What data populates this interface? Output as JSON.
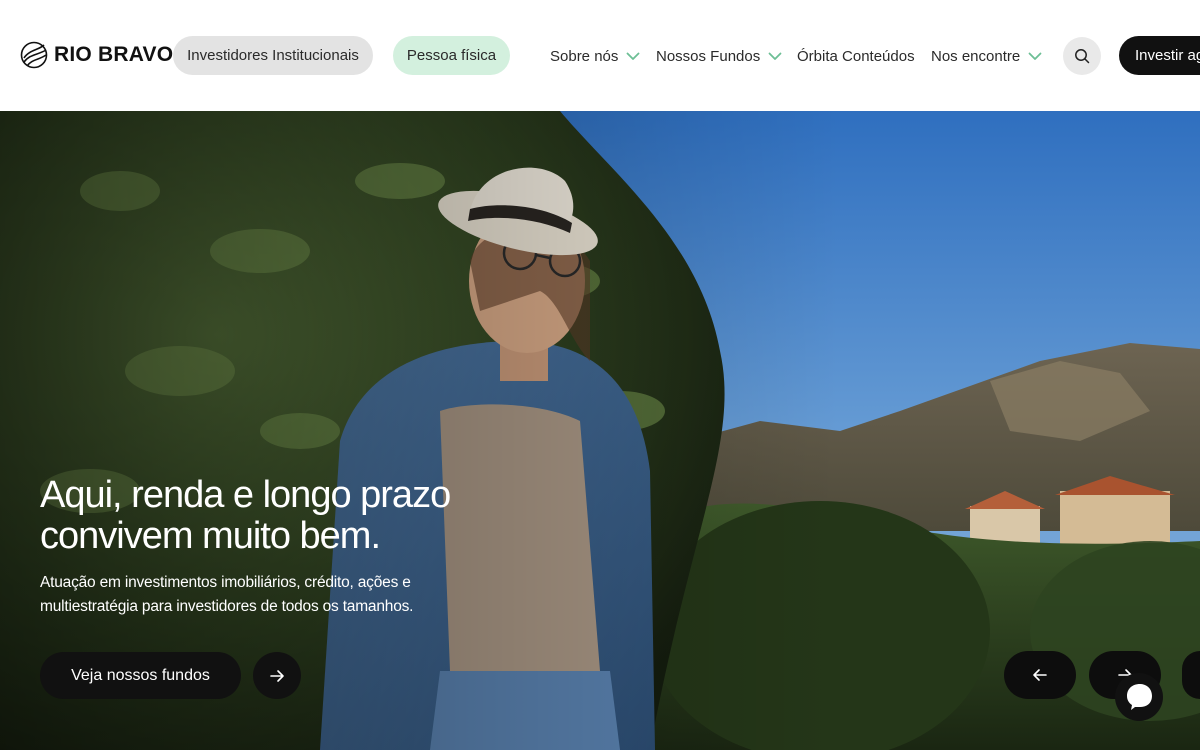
{
  "header": {
    "logo_text": "RIO BRAVO",
    "audience_tabs": [
      {
        "label": "Investidores Institucionais",
        "active": false
      },
      {
        "label": "Pessoa física",
        "active": true
      }
    ],
    "nav": [
      {
        "label": "Sobre nós",
        "has_dropdown": true
      },
      {
        "label": "Nossos Fundos",
        "has_dropdown": true
      },
      {
        "label": "Órbita Conteúdos",
        "has_dropdown": false
      },
      {
        "label": "Nos encontre",
        "has_dropdown": true
      }
    ],
    "search_icon": "search-icon",
    "cta_label": "Investir ag"
  },
  "hero": {
    "headline_line1": "Aqui, renda e longo prazo",
    "headline_line2": "convivem muito bem.",
    "subtext_line1": "Atuação em investimentos imobiliários, crédito, ações e",
    "subtext_line2": "multiestratégia para investidores de todos os tamanhos.",
    "button_label": "Veja nossos fundos",
    "button_icon": "arrow-right-icon",
    "carousel": {
      "prev_icon": "arrow-left-icon",
      "next_icon": "arrow-right-icon"
    }
  },
  "chat": {
    "icon": "chat-bubble-icon"
  },
  "colors": {
    "accent_green": "#6dbf95",
    "pill_active_bg": "#d3f0de",
    "pill_inactive_bg": "#e3e3e3",
    "dark": "#111111"
  }
}
